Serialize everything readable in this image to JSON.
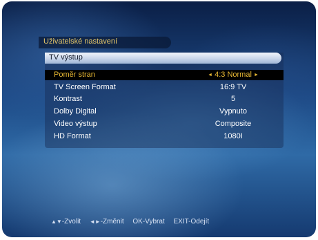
{
  "menu": {
    "title": "Uživatelské nastavení",
    "section": "TV výstup",
    "rows": [
      {
        "label": "Poměr stran",
        "value": "4:3 Normal",
        "selected": true
      },
      {
        "label": "TV Screen Format",
        "value": "16:9 TV"
      },
      {
        "label": "Kontrast",
        "value": "5"
      },
      {
        "label": "Dolby Digital",
        "value": "Vypnuto"
      },
      {
        "label": "Video výstup",
        "value": "Composite"
      },
      {
        "label": "HD Format",
        "value": "1080I"
      }
    ],
    "value_arrows": {
      "left": "◄",
      "right": "►"
    }
  },
  "help": {
    "select_symbol": "▲▼",
    "select_label": "-Zvolit",
    "change_symbol": "◄►",
    "change_label": "-Změnit",
    "ok": "OK-Vybrat",
    "exit": "EXIT-Odejít"
  },
  "colors": {
    "selected_text": "#e8b833",
    "title_text": "#e6c86a",
    "background": "#1d4a86"
  }
}
